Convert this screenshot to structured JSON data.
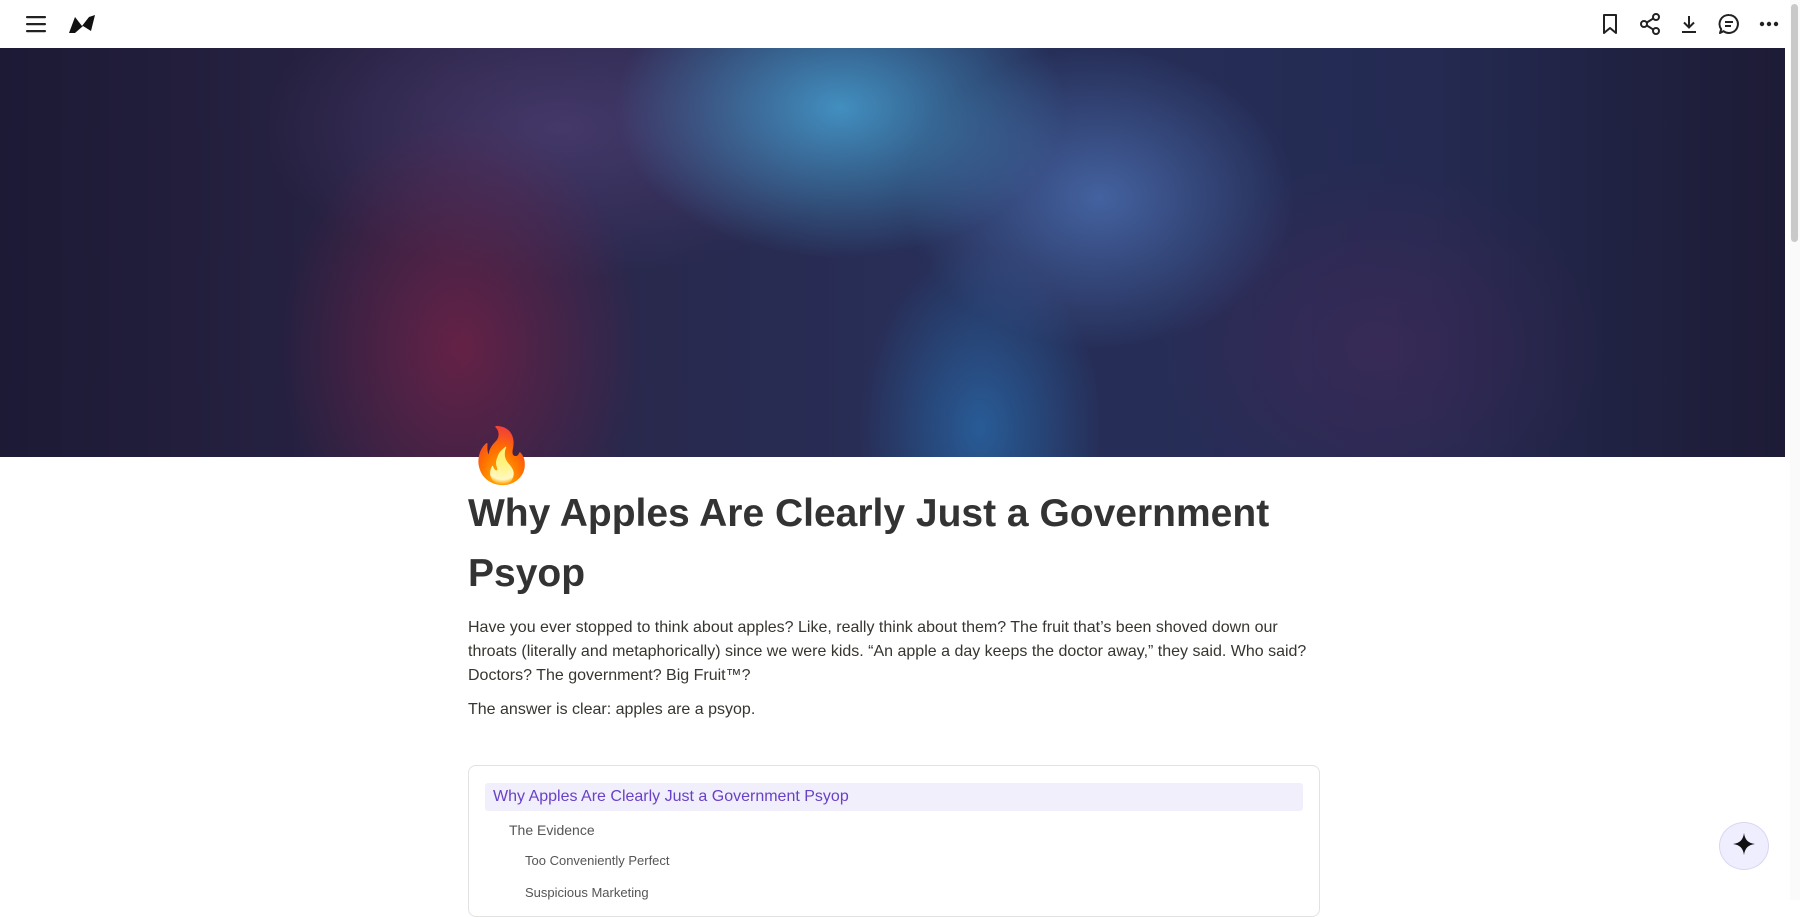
{
  "topbar": {
    "left_icons": [
      "menu-icon",
      "app-logo-icon"
    ],
    "right_icons": [
      "bookmark-icon",
      "share-icon",
      "download-icon",
      "comment-icon",
      "more-icon"
    ]
  },
  "page": {
    "emoji": "🔥",
    "title": "Why Apples Are Clearly Just a Government Psyop",
    "intro": "Have you ever stopped to think about apples? Like, really think about them? The fruit that’s been shoved down our throats (literally and metaphorically) since we were kids. “An apple a day keeps the doctor away,” they said. Who said? Doctors? The government? Big Fruit™?",
    "answer": "The answer is clear: apples are a psyop."
  },
  "toc": {
    "items": [
      {
        "label": "Why Apples Are Clearly Just a Government Psyop",
        "level": 1,
        "active": true
      },
      {
        "label": "The Evidence",
        "level": 2,
        "active": false
      },
      {
        "label": "Too Conveniently Perfect",
        "level": 3,
        "active": false
      },
      {
        "label": "Suspicious Marketing",
        "level": 3,
        "active": false
      }
    ]
  },
  "fab": {
    "icon": "sparkle-icon"
  },
  "colors": {
    "accent": "#6941c6",
    "accent_bg": "#f1effc",
    "text": "#37352f"
  }
}
